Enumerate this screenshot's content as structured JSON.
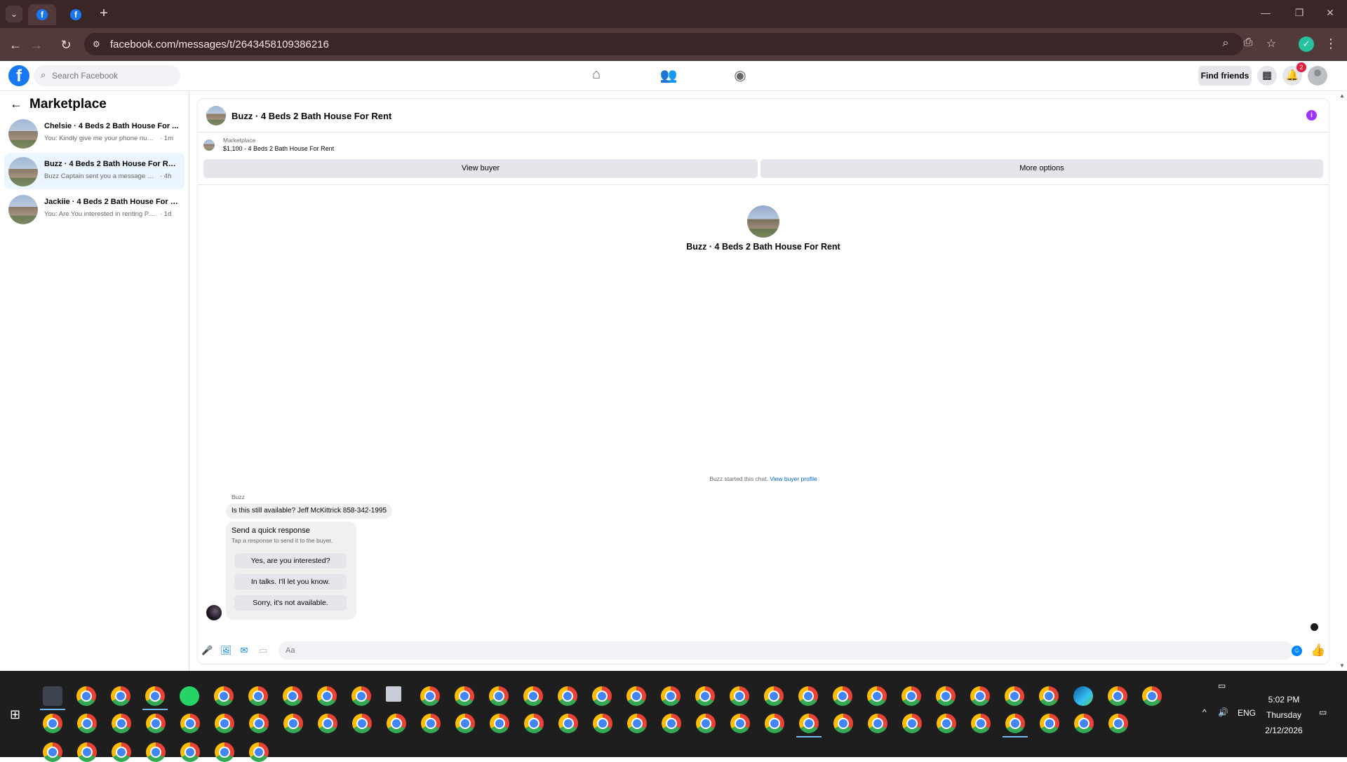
{
  "browser": {
    "url": "facebook.com/messages/t/2643458109386216"
  },
  "fb": {
    "search_placeholder": "Search Facebook",
    "find_friends": "Find friends",
    "notif_count": "2"
  },
  "sidebar": {
    "title": "Marketplace",
    "conversations": [
      {
        "name": "Chelsie · 4 Beds 2 Bath House For ...",
        "preview": "You: Kindly give me your phone num...",
        "time": "· 1m"
      },
      {
        "name": "Buzz · 4 Beds 2 Bath House For Rent",
        "preview": "Buzz Captain sent you a message abo...",
        "time": "· 4h"
      },
      {
        "name": "Jackiie · 4 Beds 2 Bath House For R...",
        "preview": "You: Are You interested in renting Ple...",
        "time": "· 1d"
      }
    ]
  },
  "chat": {
    "title": "Buzz · 4 Beds 2 Bath House For Rent",
    "marketplace_label": "Marketplace",
    "listing": "$1,100 - 4 Beds 2 Bath House For Rent",
    "view_buyer": "View buyer",
    "more_options": "More options",
    "center_name": "Buzz · 4 Beds 2 Bath House For Rent",
    "started_text": "Buzz started this chat.",
    "view_buyer_profile": "View buyer profile",
    "sender": "Buzz",
    "message": "Is this still available? Jeff McKittrick 858-342-1995",
    "quick_title": "Send a quick response",
    "quick_sub": "Tap a response to send it to the buyer.",
    "quick_responses": [
      "Yes, are you interested?",
      "In talks. I'll let you know.",
      "Sorry, it's not available."
    ],
    "composer_placeholder": "Aa"
  },
  "taskbar": {
    "time": "5:02 PM",
    "day": "Thursday",
    "date": "2/12/2026",
    "lang": "ENG"
  }
}
